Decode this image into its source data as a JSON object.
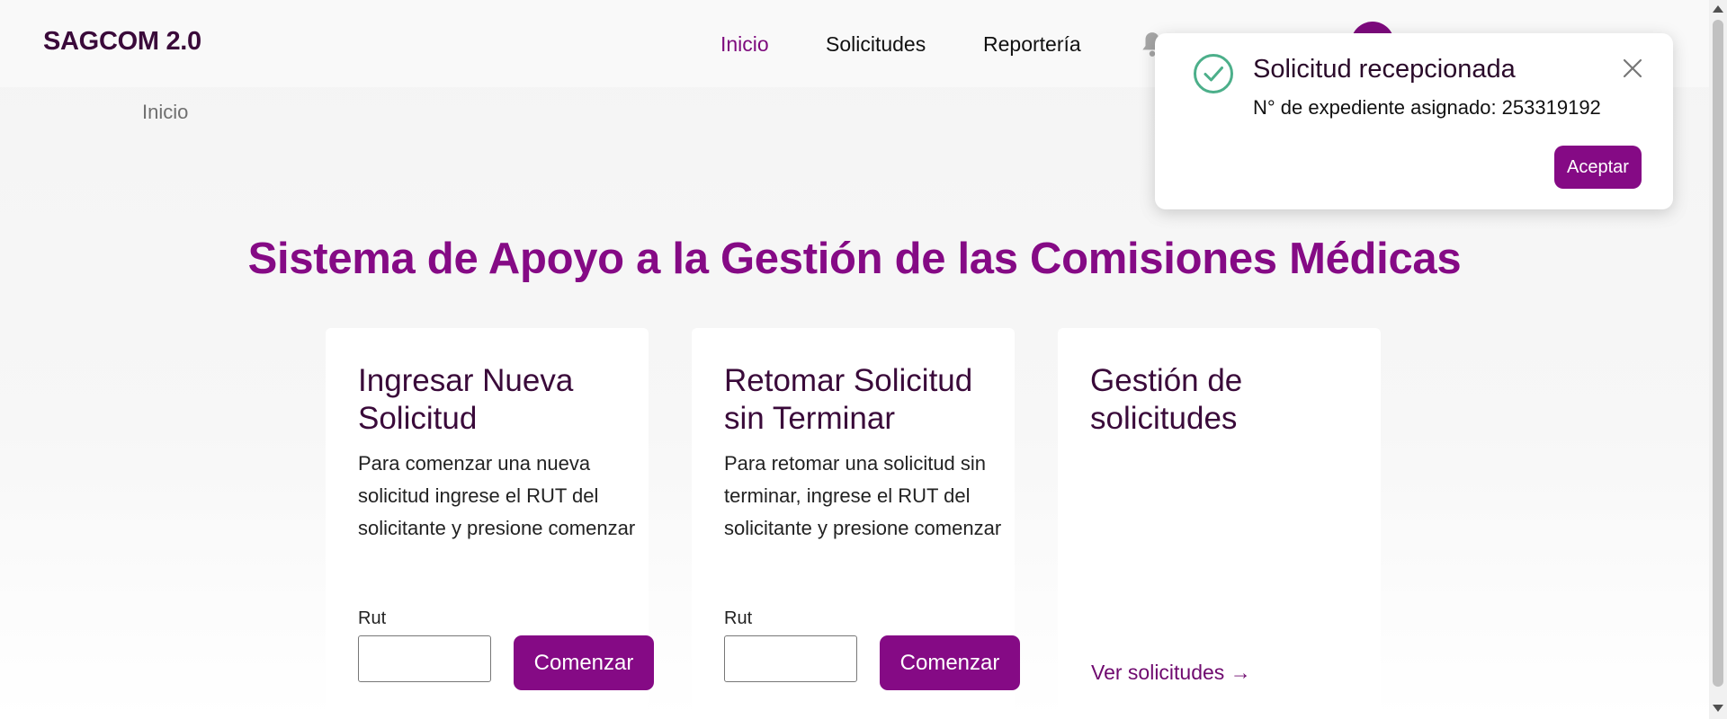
{
  "header": {
    "brand": "SAGCOM 2.0",
    "nav": [
      {
        "label": "Inicio",
        "active": true
      },
      {
        "label": "Solicitudes"
      },
      {
        "label": "Reportería"
      }
    ],
    "icons": {
      "notifications": "bell-icon",
      "user": "avatar"
    }
  },
  "breadcrumb": {
    "current": "Inicio"
  },
  "main": {
    "title": "Sistema de Apoyo a la Gestión de las Comisiones Médicas",
    "cards": [
      {
        "title": "Ingresar Nueva Solicitud",
        "description": "Para comenzar una nueva solicitud ingrese el RUT del solicitante y presione comenzar",
        "input_label": "Rut",
        "input_value": "",
        "button_label": "Comenzar"
      },
      {
        "title": "Retomar Solicitud sin Terminar",
        "description": "Para retomar una solicitud sin terminar, ingrese el RUT del solicitante y presione comenzar",
        "input_label": "Rut",
        "input_value": "",
        "button_label": "Comenzar"
      },
      {
        "title": "Gestión de solicitudes",
        "link_label": "Ver solicitudes →"
      }
    ]
  },
  "toast": {
    "title": "Solicitud recepcionada",
    "message": "N° de expediente asignado: 253319192",
    "button_label": "Aceptar",
    "icons": {
      "status": "check-circle-icon",
      "close": "close-icon"
    }
  },
  "colors": {
    "accent": "#850a85",
    "brand_text": "#3a0a3a",
    "success": "#4caf8a"
  }
}
